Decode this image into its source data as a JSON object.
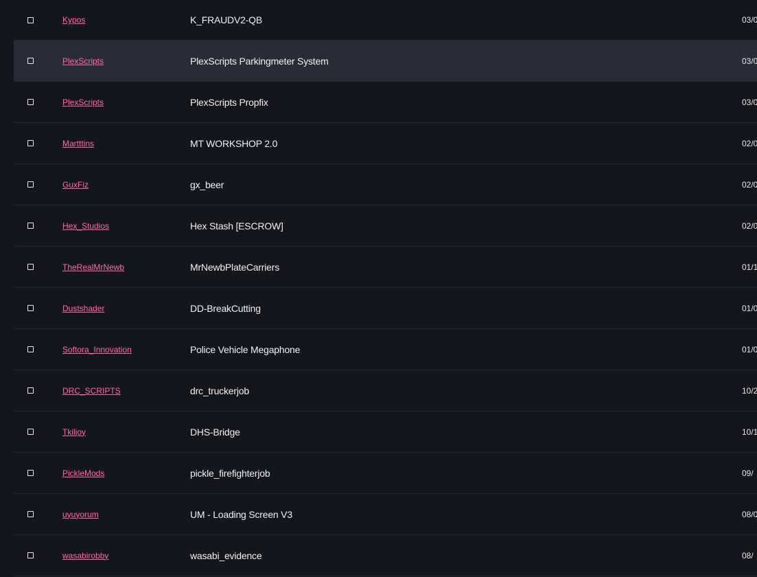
{
  "rows": [
    {
      "author": "Kypos",
      "title": "K_FRAUDV2-QB",
      "date": "03/0"
    },
    {
      "author": "PlexScripts",
      "title": "PlexScripts Parkingmeter System",
      "date": "03/0"
    },
    {
      "author": "PlexScripts",
      "title": "PlexScripts Propfix",
      "date": "03/0"
    },
    {
      "author": "Martttins",
      "title": "MT WORKSHOP 2.0",
      "date": "02/0"
    },
    {
      "author": "GuxFiz",
      "title": "gx_beer",
      "date": "02/0"
    },
    {
      "author": "Hex_Studios",
      "title": "Hex Stash [ESCROW]",
      "date": "02/0"
    },
    {
      "author": "TheRealMrNewb",
      "title": "MrNewbPlateCarriers",
      "date": "01/1"
    },
    {
      "author": "Dustshader",
      "title": "DD-BreakCutting",
      "date": "01/0"
    },
    {
      "author": "Softora_Innovation",
      "title": "Police Vehicle Megaphone",
      "date": "01/0"
    },
    {
      "author": "DRC_SCRIPTS",
      "title": "drc_truckerjob",
      "date": "10/2"
    },
    {
      "author": "Tkiljoy",
      "title": "DHS-Bridge",
      "date": "10/1"
    },
    {
      "author": "PickleMods",
      "title": "pickle_firefighterjob",
      "date": "09/"
    },
    {
      "author": "uyuyorum",
      "title": "UM - Loading Screen V3",
      "date": "08/0"
    },
    {
      "author": "wasabirobby",
      "title": "wasabi_evidence",
      "date": "08/"
    }
  ],
  "highlighted_row": 1,
  "colors": {
    "background": "#15161b",
    "row_highlight": "#2a2c35",
    "author_link": "#ff6aa8",
    "divider": "#24262d"
  }
}
